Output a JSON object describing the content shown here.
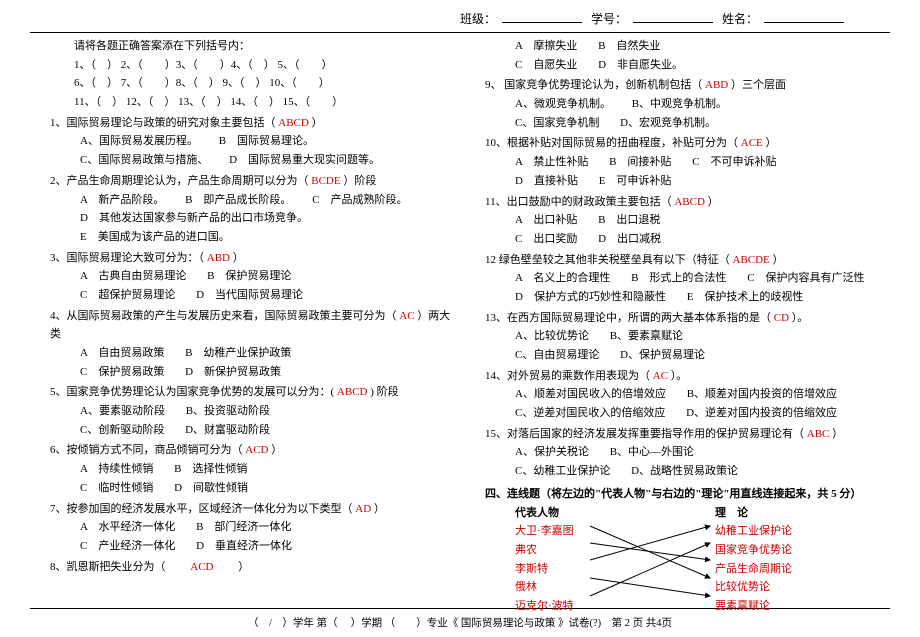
{
  "header": {
    "class_label": "班级：",
    "id_label": "学号：",
    "name_label": "姓名："
  },
  "left": {
    "instr": "请将各题正确答案添在下列括号内：",
    "rows": {
      "r1": "1、（　）  2、（　　）3、（　　）4、（　）  5、（　　）",
      "r2": "6、（　）  7、（　　）8、（　）  9、（　）  10、（　　）",
      "r3": "11、（　） 12、（　） 13、（　） 14、（　） 15、（　　）"
    },
    "q1": {
      "stem": "1、国际贸易理论与政策的研究对象主要包括（",
      "ans": "ABCD",
      "tail": "）",
      "a": "A、国际贸易发展历程。",
      "b": "B　国际贸易理论。",
      "c": "C、国际贸易政策与措施、",
      "d": "D　国际贸易重大现实问题等。"
    },
    "q2": {
      "stem": "2、产品生命周期理论认为，产品生命周期可以分为（",
      "ans": "BCDE",
      "tail": "）阶段",
      "a": "A　新产品阶段。",
      "b": "B　即产品成长阶段。",
      "c": "C　产品成熟阶段。",
      "d": "D　其他发达国家参与新产品的出口市场竞争。",
      "e": "E　美国成为该产品的进口国。"
    },
    "q3": {
      "stem": "3、国际贸易理论大致可分为：（",
      "ans": "ABD",
      "tail": "）",
      "a": "A　古典自由贸易理论",
      "b": "B　保护贸易理论",
      "c": "C　超保护贸易理论",
      "d": "D　当代国际贸易理论"
    },
    "q4": {
      "stem": "4、从国际贸易政策的产生与发展历史来看，国际贸易政策主要可分为（",
      "ans": "AC",
      "tail": "）两大类",
      "a": "A　自由贸易政策",
      "b": "B　幼稚产业保护政策",
      "c": "C　保护贸易政策",
      "d": "D　新保护贸易政策"
    },
    "q5": {
      "stem": "5、国家竞争优势理论认为国家竞争优势的发展可以分为：(",
      "ans": "ABCD",
      "tail": ") 阶段",
      "a": "A、要素驱动阶段",
      "b": "B、投资驱动阶段",
      "c": "C、创新驱动阶段",
      "d": "D、财富驱动阶段"
    },
    "q6": {
      "stem": "6、按倾销方式不同，商品倾销可分为（",
      "ans": "ACD",
      "tail": "）",
      "a": "A　持续性倾销",
      "b": "B　选择性倾销",
      "c": "C　临时性倾销",
      "d": "D　间歇性倾销"
    },
    "q7": {
      "stem": "7、按参加国的经济发展水平，区域经济一体化分为以下类型（",
      "ans": "AD",
      "tail": "）",
      "a": "A　水平经济一体化",
      "b": "B　部门经济一体化",
      "c": "C　产业经济一体化",
      "d": "D　垂直经济一体化"
    },
    "q8": {
      "stem": "8、凯恩斯把失业分为（　　",
      "ans": "ACD",
      "tail": "　　）"
    }
  },
  "right": {
    "q8opts": {
      "a": "A　摩擦失业",
      "b": "B　自然失业",
      "c": "C　自愿失业",
      "d": "D　非自愿失业。"
    },
    "q9": {
      "stem": "9、 国家竞争优势理论认为，创新机制包括（",
      "ans": "ABD",
      "tail": "）三个层面",
      "a": "A、微观竞争机制。",
      "b": "B、中观竞争机制。",
      "c": "C、国家竞争机制",
      "d": "D、宏观竞争机制。"
    },
    "q10": {
      "stem": "10、根据补贴对国际贸易的扭曲程度，补贴可分为（",
      "ans": "ACE",
      "tail": "）",
      "a": "A　禁止性补贴",
      "b": "B　间接补贴",
      "c": "C　不可申诉补贴",
      "d": "D　直接补贴",
      "e": "E　可申诉补贴"
    },
    "q11": {
      "stem": "11、出口鼓励中的财政政策主要包括（",
      "ans": "ABCD",
      "tail": "）",
      "a": "A　出口补贴",
      "b": "B　出口退税",
      "c": "C　出口奖励",
      "d": "D　出口减税"
    },
    "q12": {
      "stem": "12 绿色壁垒较之其他非关税壁垒具有以下（特征（",
      "ans": "ABCDE",
      "tail": "）",
      "a": "A　名义上的合理性",
      "b": "B　形式上的合法性",
      "c": "C　保护内容具有广泛性",
      "d": "D　保护方式的巧妙性和隐蔽性",
      "e": "E　保护技术上的歧视性"
    },
    "q13": {
      "stem": "13、在西方国际贸易理论中，所谓的两大基本体系指的是（",
      "ans": "CD",
      "tail": "）。",
      "a": "A、比较优势论",
      "b": "B、要素禀赋论",
      "c": "C、自由贸易理论",
      "d": "D、保护贸易理论"
    },
    "q14": {
      "stem": "14、对外贸易的乘数作用表现为（",
      "ans": "AC",
      "tail": "）。",
      "a": "A、顺差对国民收入的倍增效应",
      "b": "B、顺差对国内投资的倍增效应",
      "c": "C、逆差对国民收入的倍缩效应",
      "d": "D、逆差对国内投资的倍缩效应"
    },
    "q15": {
      "stem": "15、对落后国家的经济发展发挥重要指导作用的保护贸易理论有（",
      "ans": "ABC",
      "tail": "）",
      "a": "A、保护关税论",
      "b": "B、中心—外围论",
      "c": "C、幼稚工业保护论",
      "d": "D、战略性贸易政策论"
    },
    "section4": "四、连线题（将左边的\"代表人物\"与右边的\"理论\"用直线连接起来，共 5 分）",
    "match": {
      "lh": "代表人物",
      "rh": "理　论",
      "l1": "大卫·李嘉图",
      "l2": "弗农",
      "l3": "李斯特",
      "l4": "俄林",
      "l5": "迈克尔·波特",
      "r1": "幼稚工业保护论",
      "r2": "国家竞争优势论",
      "r3": "产品生命周期论",
      "r4": "比较优势论",
      "r5": "要素禀赋论"
    }
  },
  "footer": "（　/　）学年 第（ 　）学期 （　　）专业《 国际贸易理论与政策 》试卷(?)　第 2 页  共4页"
}
